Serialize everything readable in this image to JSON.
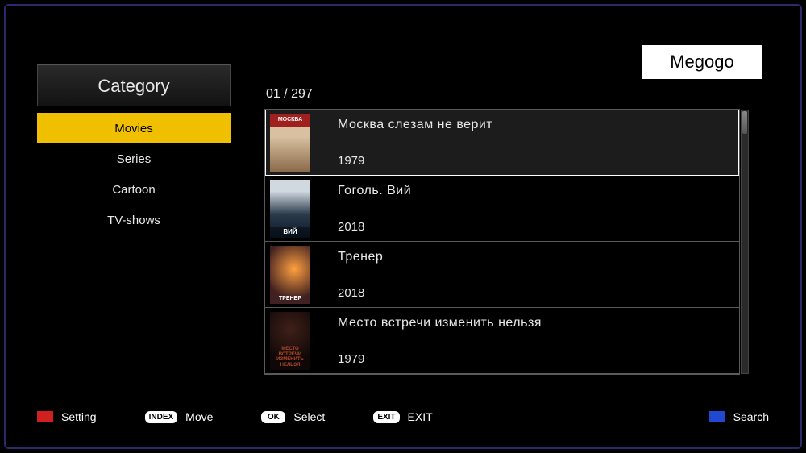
{
  "brand": "Megogo",
  "sidebar": {
    "title": "Category",
    "items": [
      {
        "label": "Movies",
        "selected": true
      },
      {
        "label": "Series",
        "selected": false
      },
      {
        "label": "Cartoon",
        "selected": false
      },
      {
        "label": "TV-shows",
        "selected": false
      }
    ]
  },
  "counter": "01 / 297",
  "list": [
    {
      "title": "Москва слезам не верит",
      "year": "1979",
      "poster_text_top": "МОСКВА",
      "selected": true
    },
    {
      "title": "Гоголь. Вий",
      "year": "2018",
      "poster_text": "ВИЙ",
      "selected": false
    },
    {
      "title": "Тренер",
      "year": "2018",
      "poster_text": "ТРЕНЕР",
      "selected": false
    },
    {
      "title": "Место встречи изменить нельзя",
      "year": "1979",
      "poster_text": "МЕСТО ВСТРЕЧИ ИЗМЕНИТЬ НЕЛЬЗЯ",
      "selected": false
    }
  ],
  "hotkeys": {
    "setting": "Setting",
    "move_badge": "INDEX",
    "move": "Move",
    "select_badge": "OK",
    "select": "Select",
    "exit_badge": "EXIT",
    "exit": "EXIT",
    "search": "Search"
  }
}
